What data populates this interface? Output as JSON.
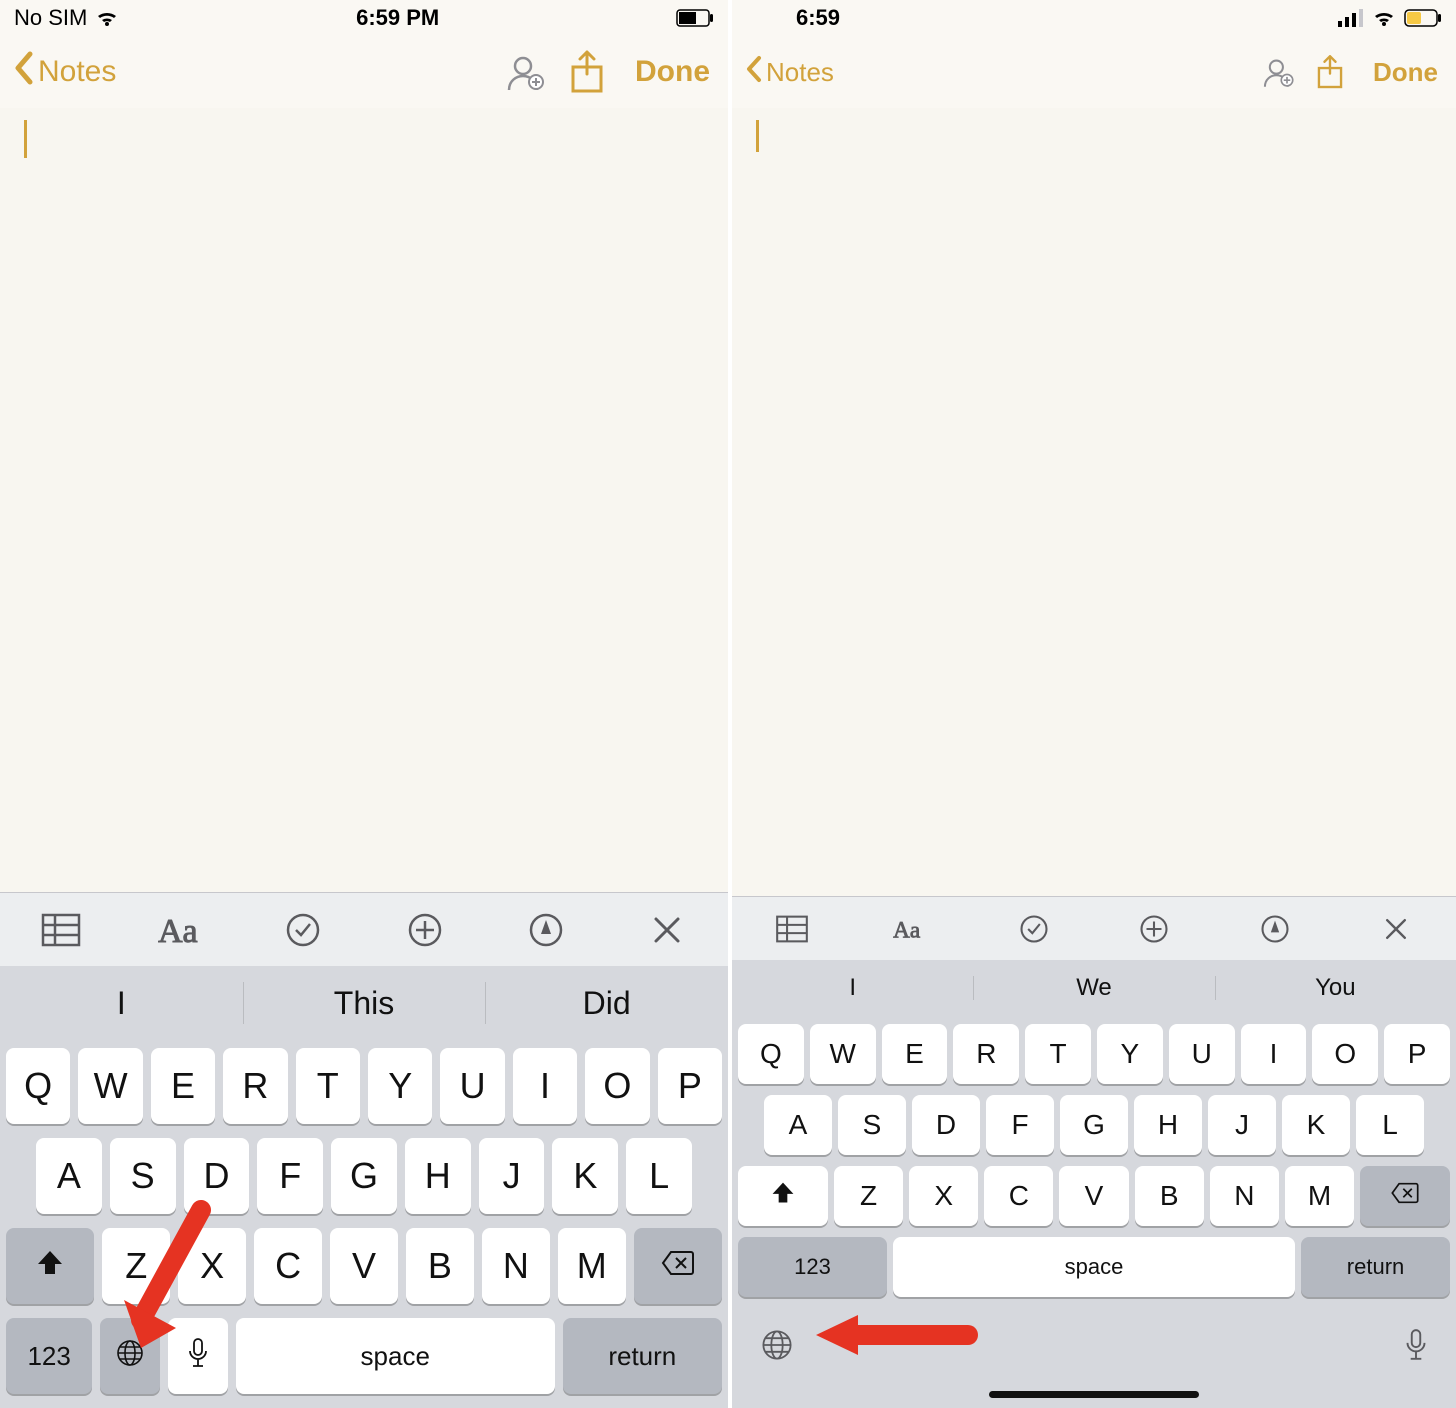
{
  "left": {
    "status": {
      "carrier": "No SIM",
      "time": "6:59 PM"
    },
    "nav": {
      "back": "Notes",
      "done": "Done"
    },
    "suggestions": [
      "I",
      "This",
      "Did"
    ],
    "keys": {
      "row1": [
        "Q",
        "W",
        "E",
        "R",
        "T",
        "Y",
        "U",
        "I",
        "O",
        "P"
      ],
      "row2": [
        "A",
        "S",
        "D",
        "F",
        "G",
        "H",
        "J",
        "K",
        "L"
      ],
      "row3": [
        "Z",
        "X",
        "C",
        "V",
        "B",
        "N",
        "M"
      ],
      "num": "123",
      "space": "space",
      "return": "return"
    }
  },
  "right": {
    "status": {
      "time": "6:59"
    },
    "nav": {
      "back": "Notes",
      "done": "Done"
    },
    "suggestions": [
      "I",
      "We",
      "You"
    ],
    "keys": {
      "row1": [
        "Q",
        "W",
        "E",
        "R",
        "T",
        "Y",
        "U",
        "I",
        "O",
        "P"
      ],
      "row2": [
        "A",
        "S",
        "D",
        "F",
        "G",
        "H",
        "J",
        "K",
        "L"
      ],
      "row3": [
        "Z",
        "X",
        "C",
        "V",
        "B",
        "N",
        "M"
      ],
      "num": "123",
      "space": "space",
      "return": "return"
    }
  }
}
